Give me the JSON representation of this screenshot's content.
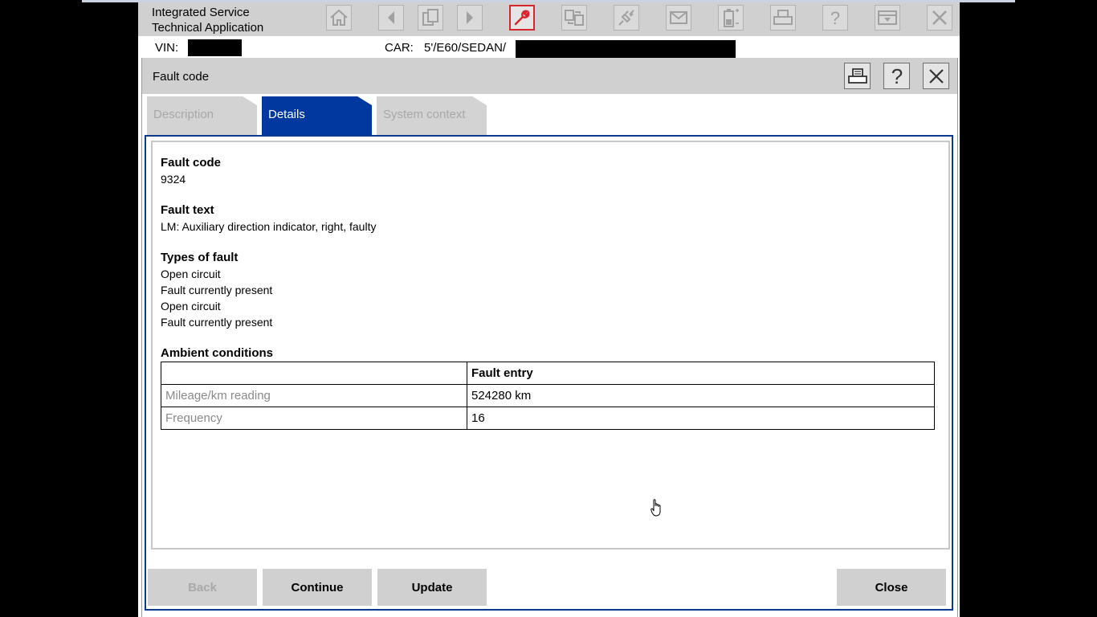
{
  "app": {
    "title": "Integrated Service\nTechnical Application"
  },
  "toolbar": {
    "icons": [
      "home-icon",
      "back-arrow-icon",
      "documents-icon",
      "forward-arrow-icon",
      "wrench-icon",
      "vehicle-swap-icon",
      "plug-icon",
      "mail-icon",
      "battery-icon",
      "printer-icon",
      "help-icon",
      "minimize-icon",
      "close-icon"
    ],
    "active_icon": "wrench-icon"
  },
  "vehicle": {
    "vin_label": "VIN:",
    "car_label": "CAR:",
    "car_value": "5'/E60/SEDAN/"
  },
  "dialog": {
    "title": "Fault code",
    "header_icons": [
      "printer-icon",
      "help-icon",
      "close-icon"
    ],
    "tabs": [
      {
        "label": "Description",
        "state": "disabled"
      },
      {
        "label": "Details",
        "state": "selected"
      },
      {
        "label": "System context",
        "state": "disabled"
      }
    ]
  },
  "details": {
    "fault_code_title": "Fault code",
    "fault_code": "9324",
    "fault_text_title": "Fault text",
    "fault_text": "LM: Auxiliary direction indicator, right, faulty",
    "types_title": "Types of fault",
    "types": [
      "Open circuit",
      "Fault currently present",
      "Open circuit",
      "Fault currently present"
    ],
    "ambient_title": "Ambient conditions",
    "table": {
      "header": [
        "",
        "Fault entry"
      ],
      "rows": [
        [
          "Mileage/km reading",
          "524280 km"
        ],
        [
          "Frequency",
          "16"
        ]
      ]
    }
  },
  "buttons": {
    "back": "Back",
    "continue": "Continue",
    "update": "Update",
    "close": "Close"
  },
  "colors": {
    "accent_blue": "#0038a0",
    "active_tool_red": "#d8262e",
    "toolbar_gray": "#d0d0d0"
  }
}
